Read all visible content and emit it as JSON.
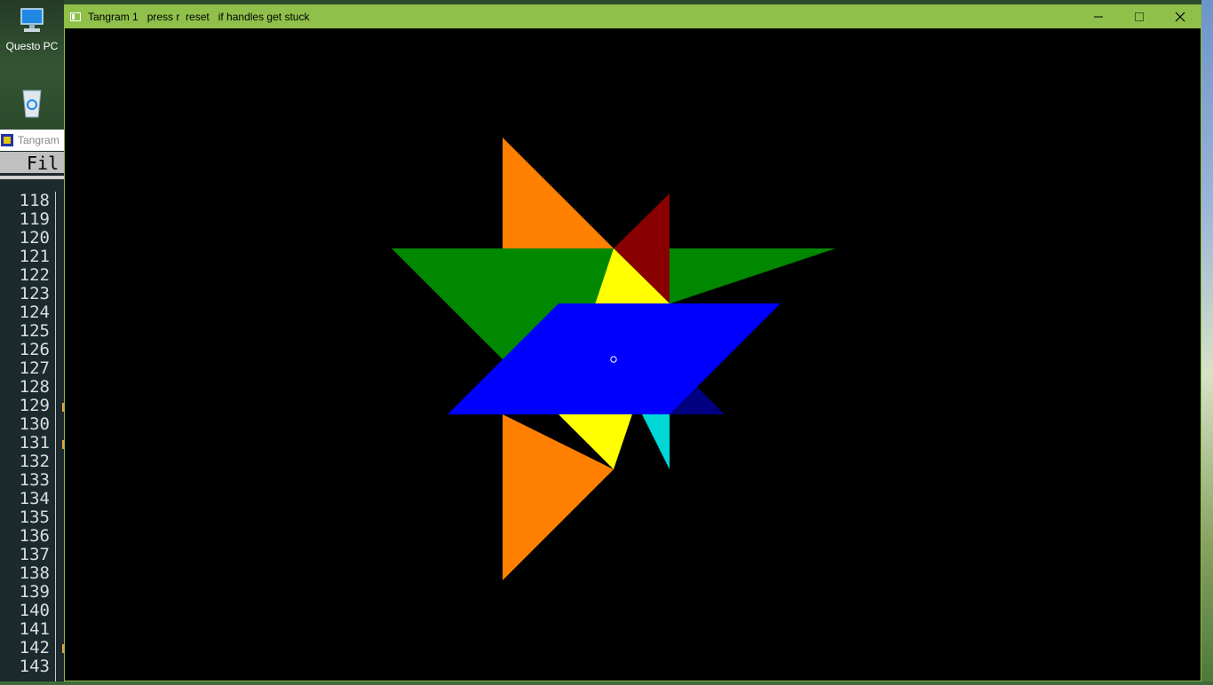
{
  "window": {
    "title": "Tangram 1   press r  reset   if handles get stuck",
    "controls": {
      "minimize": "minimize",
      "maximize": "maximize",
      "close": "close"
    }
  },
  "desktop": {
    "icons": [
      {
        "label": "Questo PC",
        "icon": "computer-icon"
      },
      {
        "label": "",
        "icon": "recycle-bin-icon"
      }
    ]
  },
  "background_window": {
    "title": "Tangram",
    "menu": "Fil",
    "line_numbers": [
      "118",
      "119",
      "120",
      "121",
      "122",
      "123",
      "124",
      "125",
      "126",
      "127",
      "128",
      "129",
      "130",
      "131",
      "132",
      "133",
      "134",
      "135",
      "136",
      "137",
      "138",
      "139",
      "140",
      "141",
      "142",
      "143"
    ]
  },
  "tangram": {
    "pieces": [
      {
        "name": "orange-triangle-top",
        "color": "#ff8000"
      },
      {
        "name": "orange-triangle-bottom",
        "color": "#ff8000"
      },
      {
        "name": "green-triangle",
        "color": "#008800"
      },
      {
        "name": "dark-red-triangle",
        "color": "#880000"
      },
      {
        "name": "yellow-square",
        "color": "#ffff00"
      },
      {
        "name": "blue-parallelogram",
        "color": "#0000ff"
      },
      {
        "name": "navy-triangle",
        "color": "#000080"
      },
      {
        "name": "cyan-triangle",
        "color": "#00d8d8"
      }
    ],
    "handle": "rotation-handle"
  }
}
